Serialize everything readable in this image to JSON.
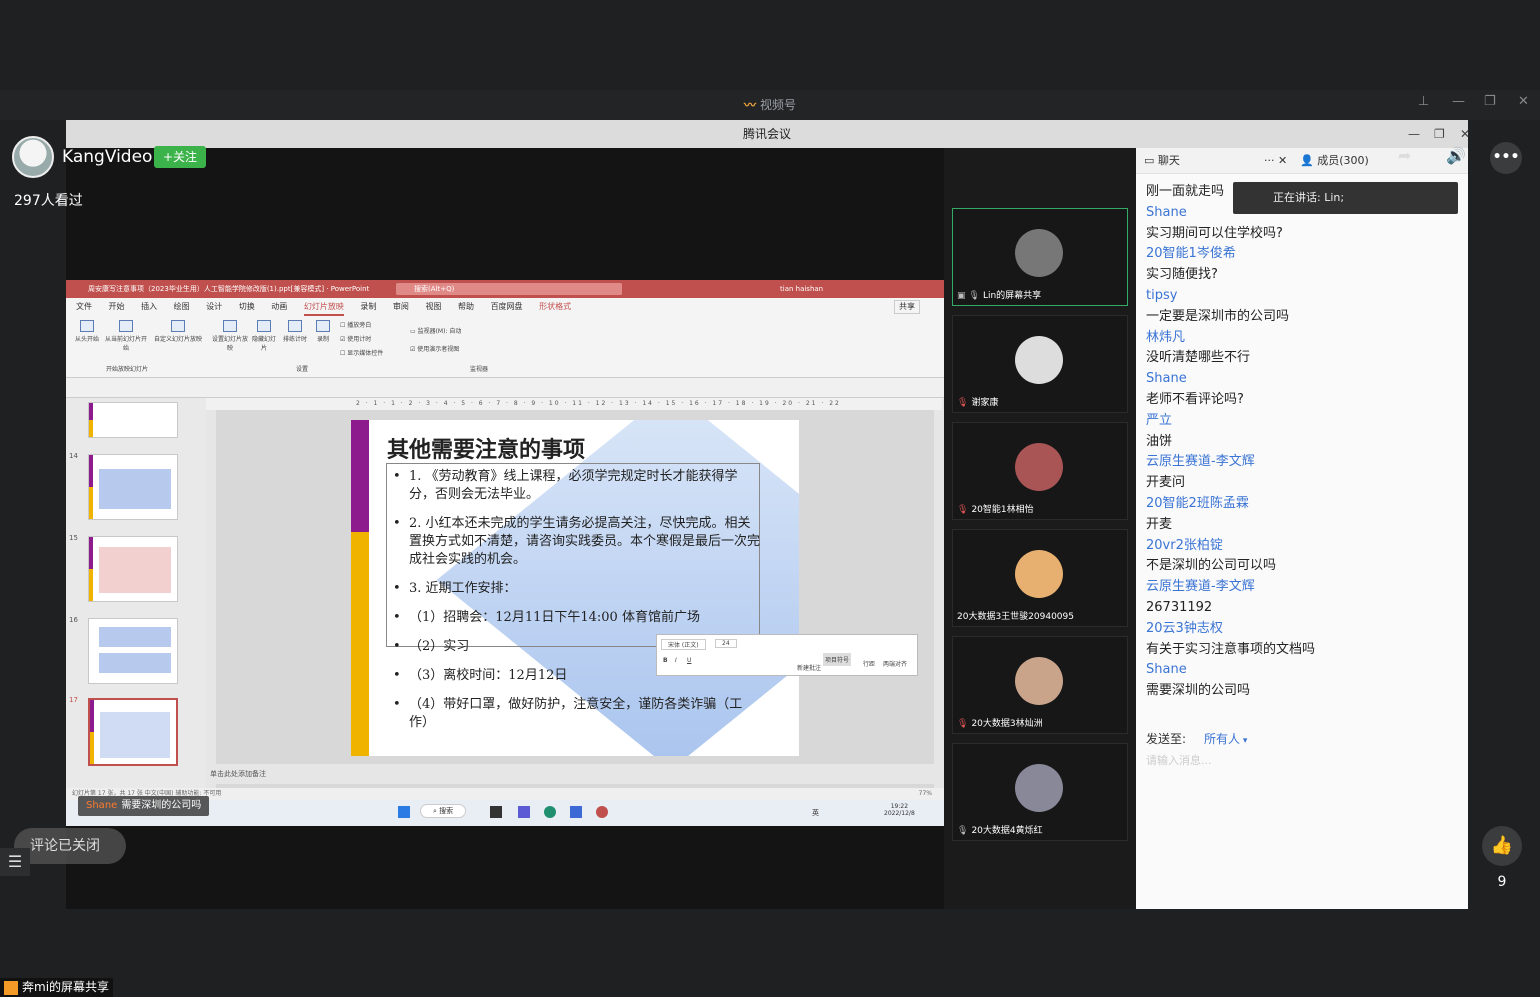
{
  "channel": {
    "logo": "〰",
    "title": "视频号",
    "controls": [
      "⊥",
      "—",
      "❐",
      "✕"
    ]
  },
  "meeting": {
    "title": "腾讯会议",
    "controls": [
      "—",
      "❐",
      "✕"
    ]
  },
  "streamer": {
    "name": "KangVideo",
    "follow": "+关注",
    "viewers": "297人看过"
  },
  "ppt": {
    "title": "周安康写注意事项（2023毕业生用）人工智能学院修改版(1).ppt[兼容模式] · PowerPoint",
    "search": "搜索(Alt+Q)",
    "user": "tian haishan",
    "menu": [
      "文件",
      "开始",
      "插入",
      "绘图",
      "设计",
      "切换",
      "动画",
      "幻灯片放映",
      "录制",
      "审阅",
      "视图",
      "帮助",
      "百度网盘",
      "形状格式"
    ],
    "share": "共享",
    "ribbon": [
      "从头开始",
      "从当前幻灯片开始",
      "自定义幻灯片放映",
      "设置幻灯片放映",
      "隐藏幻灯片",
      "排练计时",
      "录制"
    ],
    "ribbon_checks": [
      "播放旁白",
      "使用计时",
      "显示媒体控件"
    ],
    "monitor": "监视器(M): 自动",
    "presenter": "使用演示者视图",
    "group_labels": [
      "开始放映幻灯片",
      "设置",
      "监视器"
    ],
    "thumb_numbers": [
      "14",
      "15",
      "16",
      "17"
    ],
    "ruler": "2 · 1 · 1 · 2 · 3 · 4 · 5 · 6 · 7 · 8 · 9 · 10 · 11 · 12 · 13 · 14 · 15 · 16 · 17 · 18 · 19 · 20 · 21 · 22",
    "slide_title": "其他需要注意的事项",
    "slide_items": [
      "1. 《劳动教育》线上课程，必须学完规定时长才能获得学分，否则会无法毕业。",
      "2. 小红本还未完成的学生请务必提高关注，尽快完成。相关置换方式如不清楚，请咨询实践委员。本个寒假是最后一次完成社会实践的机会。",
      "3. 近期工作安排：",
      "（1）招聘会：12月11日下午14:00 体育馆前广场",
      "（2）实习",
      "（3）离校时间：12月12日",
      "（4）带好口罩，做好防护，注意安全，谨防各类诈骗（工作）"
    ],
    "mini_toolbar": {
      "font": "宋体 (正文)",
      "size": "24",
      "labels": [
        "新建批注",
        "项目符号",
        "行距",
        "两端对齐"
      ]
    },
    "notes": "单击此处添加备注",
    "status": "幻灯片第 17 张，共 17 张    中文(中国)    辅助功能: 不可用",
    "zoom": "77%",
    "taskbar": {
      "search": "搜索",
      "time": "19:22",
      "date": "2022/12/8",
      "lang": "英"
    }
  },
  "toast": {
    "name": "Shane",
    "text": "需要深圳的公司吗"
  },
  "videos": [
    {
      "name": "Lin的屏幕共享",
      "mic": "on"
    },
    {
      "name": "谢家康",
      "mic": "off"
    },
    {
      "name": "20智能1林相怡",
      "mic": "off"
    },
    {
      "name": "20大数据3王世骏20940095",
      "mic": "none"
    },
    {
      "name": "20大数据3林灿洲",
      "mic": "off"
    },
    {
      "name": "20大数据4黄烁红",
      "mic": "on"
    }
  ],
  "chat": {
    "tab_chat": "聊天",
    "tab_members": "成员(300)",
    "speaking": "正在讲话: Lin;",
    "messages": [
      {
        "t": "m",
        "v": "刚一面就走吗"
      },
      {
        "t": "u",
        "v": "Shane"
      },
      {
        "t": "m",
        "v": "实习期间可以住学校吗?"
      },
      {
        "t": "u",
        "v": "20智能1岑俊希"
      },
      {
        "t": "m",
        "v": "实习随便找?"
      },
      {
        "t": "u",
        "v": "tipsy"
      },
      {
        "t": "m",
        "v": "一定要是深圳市的公司吗"
      },
      {
        "t": "u",
        "v": "林炜凡"
      },
      {
        "t": "m",
        "v": "没听清楚哪些不行"
      },
      {
        "t": "u",
        "v": "Shane"
      },
      {
        "t": "m",
        "v": "老师不看评论吗?"
      },
      {
        "t": "u",
        "v": "严立"
      },
      {
        "t": "m",
        "v": "油饼"
      },
      {
        "t": "u",
        "v": "云原生赛道-李文辉"
      },
      {
        "t": "m",
        "v": "开麦问"
      },
      {
        "t": "u",
        "v": "20智能2班陈孟霖"
      },
      {
        "t": "m",
        "v": "开麦"
      },
      {
        "t": "u",
        "v": "20vr2张柏锭"
      },
      {
        "t": "m",
        "v": "不是深圳的公司可以吗"
      },
      {
        "t": "u",
        "v": "云原生赛道-李文辉"
      },
      {
        "t": "m",
        "v": "26731192"
      },
      {
        "t": "u",
        "v": "20云3钟志权"
      },
      {
        "t": "m",
        "v": "有关于实习注意事项的文档吗"
      },
      {
        "t": "u",
        "v": "Shane"
      },
      {
        "t": "m",
        "v": "需要深圳的公司吗"
      }
    ],
    "send_to": "发送至:",
    "recipient": "所有人",
    "input_placeholder": "请输入消息..."
  },
  "overlay": {
    "comments_off": "评论已关闭",
    "likes": "9",
    "bottom_share": "奔mi的屏幕共享"
  }
}
